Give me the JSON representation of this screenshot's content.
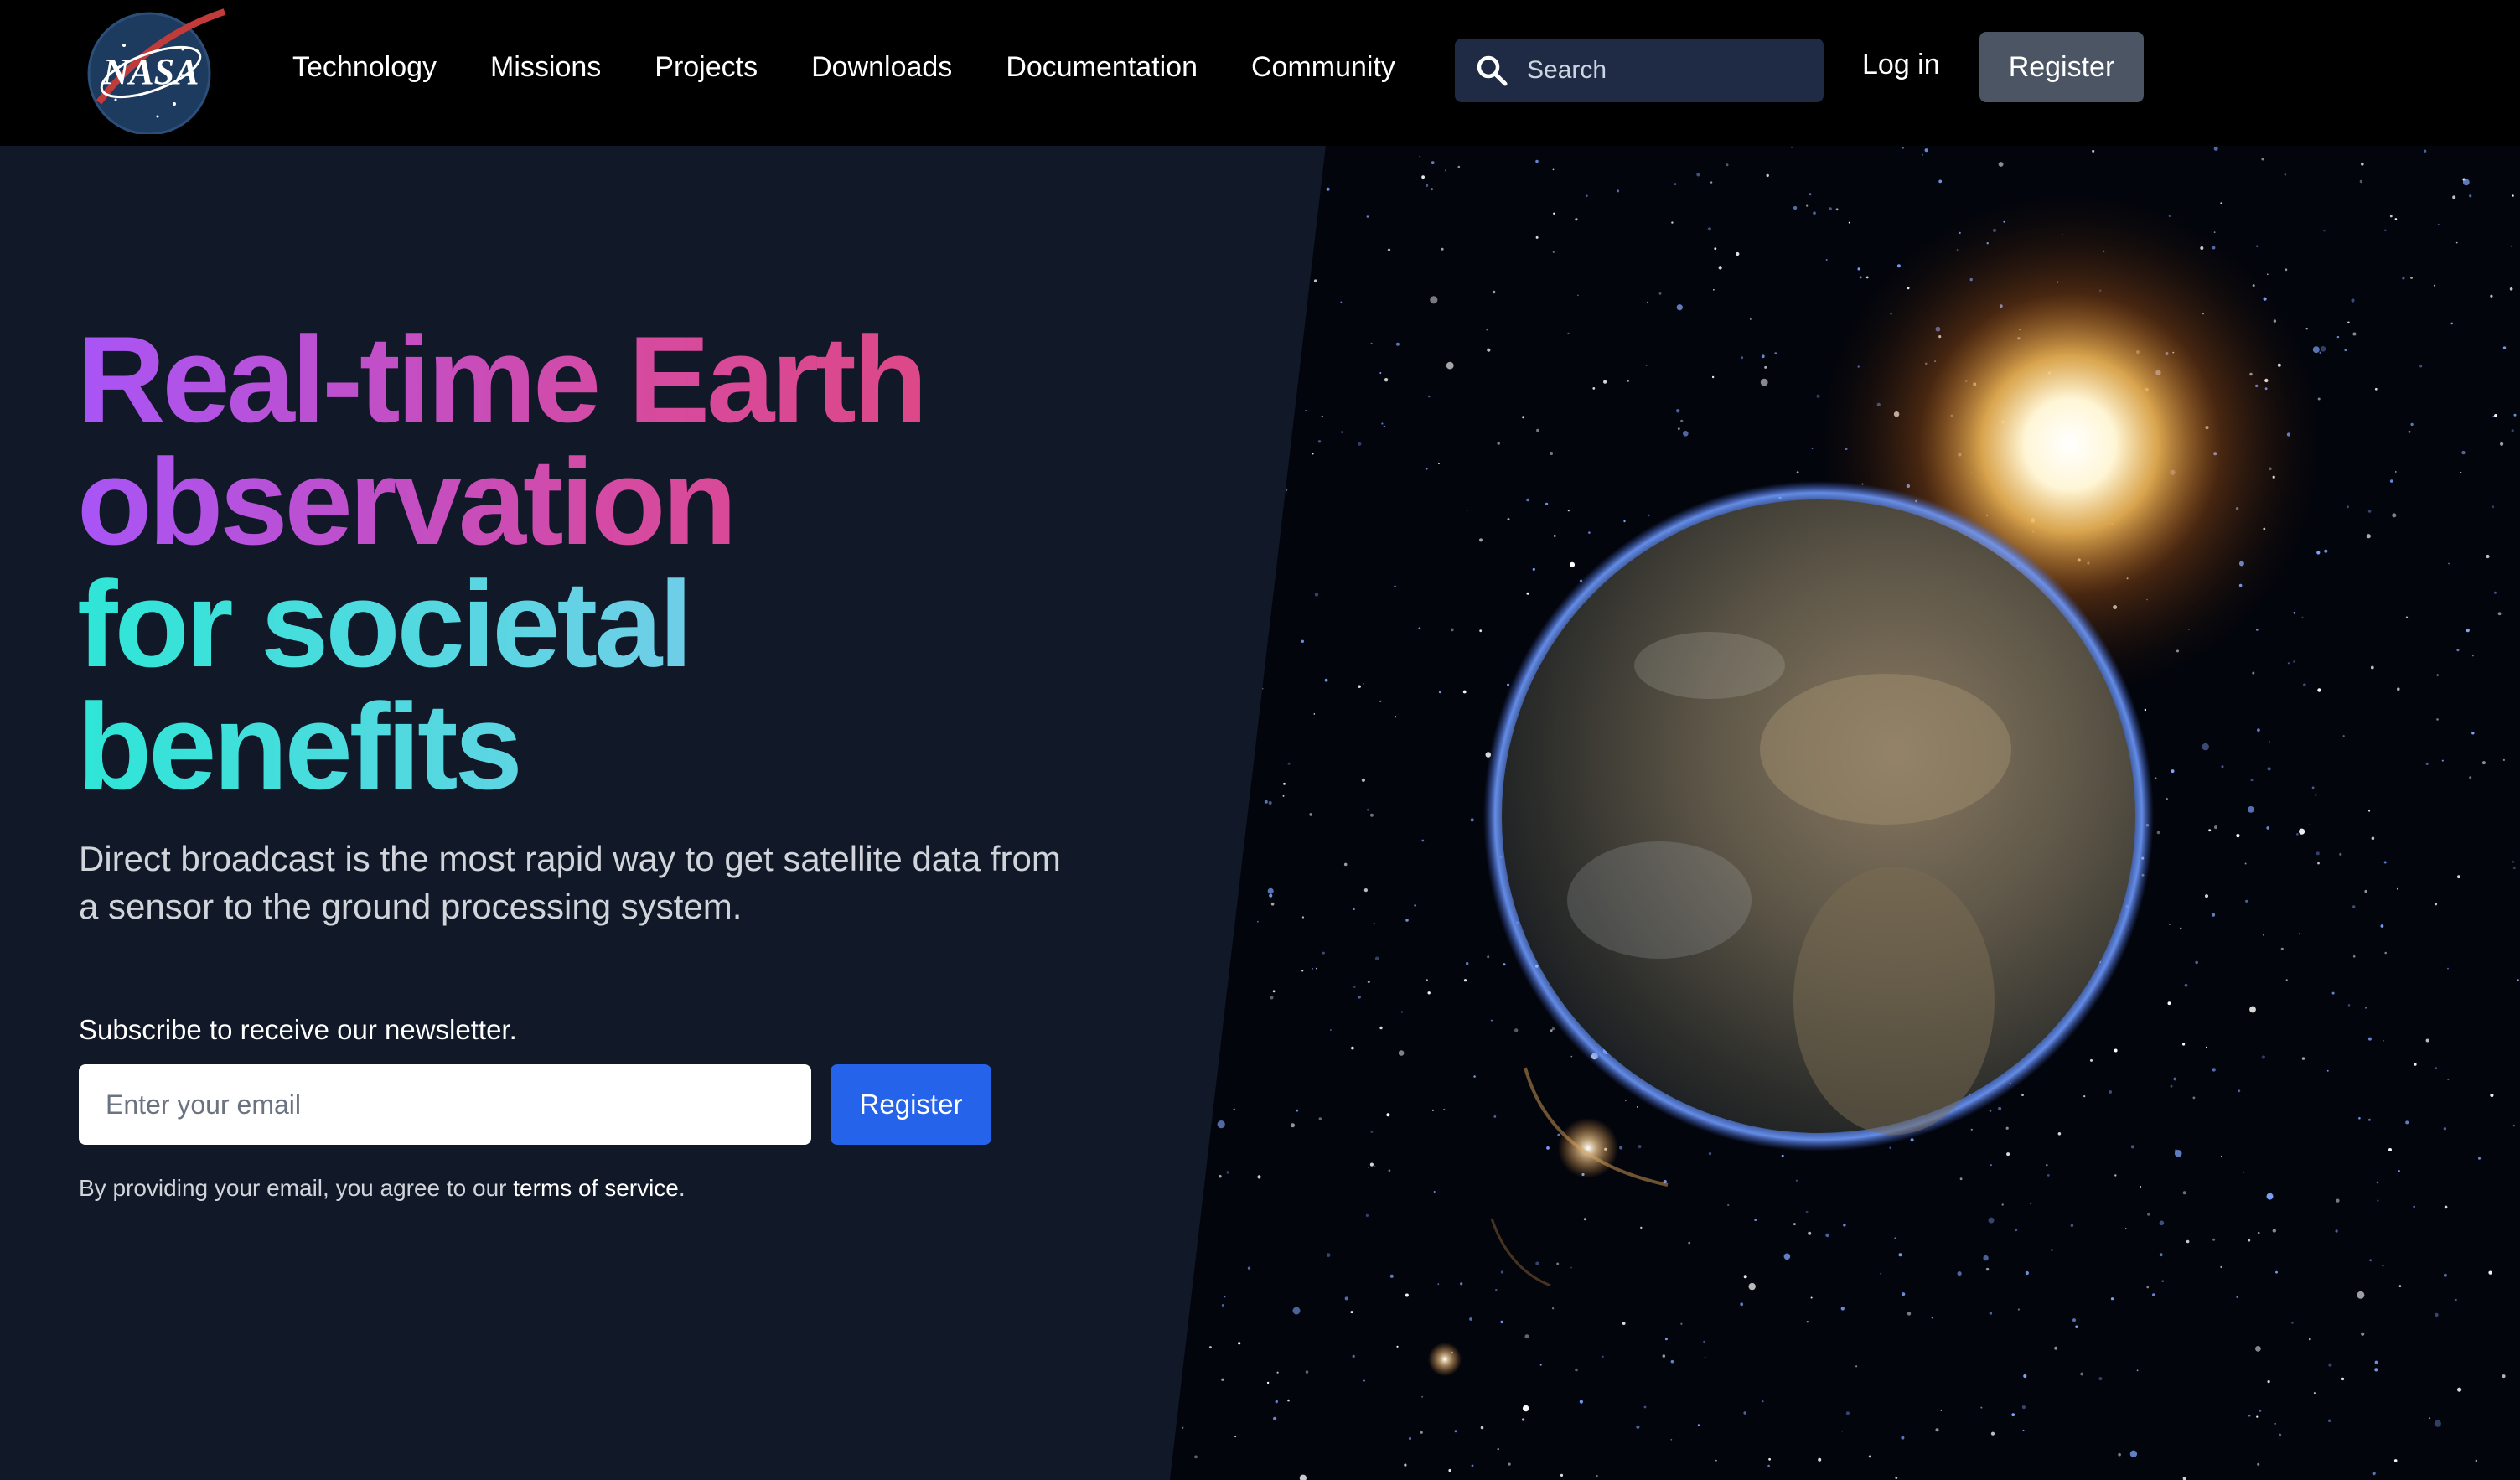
{
  "nav": {
    "logo_text": "NASA",
    "links": [
      "Technology",
      "Missions",
      "Projects",
      "Downloads",
      "Documentation",
      "Community"
    ],
    "search_placeholder": "Search",
    "login_label": "Log in",
    "register_label": "Register"
  },
  "hero": {
    "headline_line1": "Real-time Earth",
    "headline_line2": "observation",
    "headline_line3": "for societal",
    "headline_line4": "benefits",
    "lead": "Direct broadcast is the most rapid way to get satellite data from a sensor to the ground processing system.",
    "subscribe_label": "Subscribe to receive our newsletter.",
    "email_placeholder": "Enter your email",
    "submit_label": "Register",
    "terms_prefix": "By providing your email, you agree to our ",
    "terms_link": "terms of service",
    "terms_suffix": "."
  },
  "colors": {
    "nav_bg": "#000000",
    "page_bg": "#111827",
    "primary_button": "#2563eb",
    "secondary_button": "#4b5563",
    "search_bg": "#1f2a44"
  },
  "icons": [
    "nasa-logo",
    "search-icon"
  ]
}
